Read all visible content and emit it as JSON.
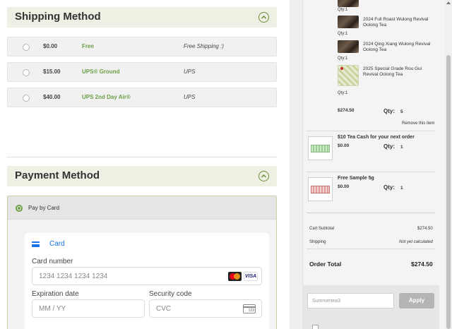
{
  "shipping": {
    "title": "Shipping Method",
    "options": [
      {
        "price": "$0.00",
        "name": "Free",
        "carrier": "Free Shipping :)"
      },
      {
        "price": "$15.00",
        "name": "UPS® Ground",
        "carrier": "UPS"
      },
      {
        "price": "$40.00",
        "name": "UPS 2nd Day Air®",
        "carrier": "UPS"
      }
    ]
  },
  "payment": {
    "title": "Payment Method",
    "option_label": "Pay by Card",
    "card_tab": "Card",
    "card_number_label": "Card number",
    "card_number_placeholder": "1234 1234 1234 1234",
    "brand_visa": "VISA",
    "expiry_label": "Expiration date",
    "expiry_placeholder": "MM / YY",
    "security_label": "Security code",
    "security_placeholder": "CVC",
    "cvc_icon_text": "123"
  },
  "cart": {
    "top_partial_qty": "Qty:1",
    "items": [
      {
        "name": "2024 Full Roast Wulong Revival Oolong Tea",
        "qty": "Qty:1",
        "icon": "tea-photo-icon"
      },
      {
        "name": "2024 Qing Xiang Wulong Revival Oolong Tea",
        "qty": "Qty:1",
        "icon": "tea-photo-icon"
      },
      {
        "name": "2025 Special Grade Rou Gui Revival Oolong Tea",
        "qty": "Qty:1",
        "icon": "tea-package-icon"
      }
    ],
    "bundle_price": "$274.50",
    "bundle_qty_label": "Qty:",
    "bundle_qty": "5",
    "remove_label": "Remove this item",
    "promos": [
      {
        "name": "$10 Tea Cash for your next order",
        "price": "$0.00",
        "qty_label": "Qty:",
        "qty": "1"
      },
      {
        "name": "Free Sample 5g",
        "price": "$0.00",
        "qty_label": "Qty:",
        "qty": "1"
      }
    ]
  },
  "totals": {
    "subtotal_label": "Cart Subtotal",
    "subtotal_value": "$274.50",
    "shipping_label": "Shipping",
    "shipping_value": "Not yet calculated",
    "order_total_label": "Order Total",
    "order_total_value": "$274.50"
  },
  "coupon": {
    "value": "Summertea3",
    "apply_label": "Apply"
  },
  "colors": {
    "accent_green": "#6b9d45",
    "link_blue": "#1a73e8",
    "header_bg": "#eef0e4"
  }
}
